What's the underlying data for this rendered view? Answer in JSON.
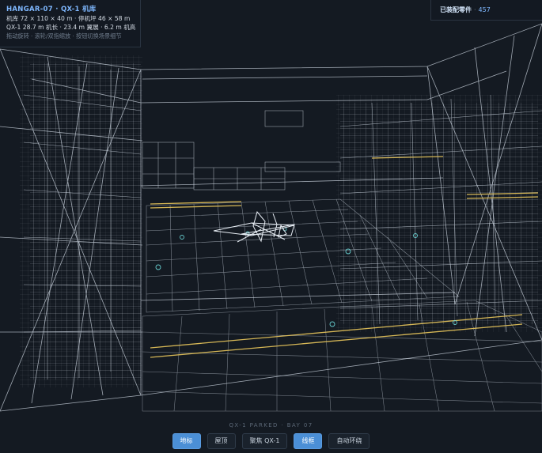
{
  "info": {
    "title": "HANGAR-07 · QX-1 机库",
    "line1": "机库 72 × 110 × 40 m · 停机坪 46 × 58 m",
    "line2": "QX-1 28.7 m 机长 · 23.4 m 翼展 · 6.2 m 机高",
    "hint": "拖动旋转 · 滚轮/双指缩放 · 按钮切换场景细节"
  },
  "parts": {
    "label": "已装配零件",
    "separator": "·",
    "count": "457"
  },
  "status": "QX-1 PARKED · BAY 07",
  "toolbar": {
    "buttons": [
      {
        "label": "地标",
        "active": true
      },
      {
        "label": "屋顶",
        "active": false
      },
      {
        "label": "聚焦 QX-1",
        "active": false
      },
      {
        "label": "线框",
        "active": true
      },
      {
        "label": "自动环绕",
        "active": false
      }
    ]
  },
  "colors": {
    "accent": "#4b8fd6",
    "wire": "#cfd8e3",
    "highlight": "#e0c05a",
    "cyan": "#6fe0e0",
    "background": "#141a22"
  },
  "icons": {
    "aircraft": "aircraft-icon"
  }
}
